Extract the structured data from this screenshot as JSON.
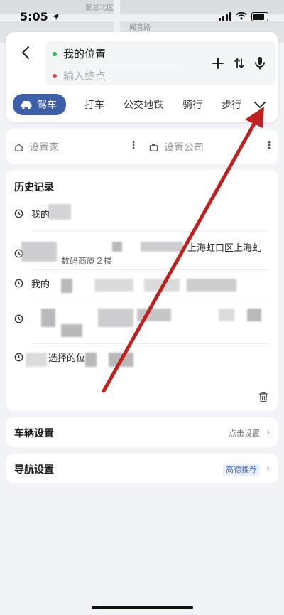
{
  "status_bar": {
    "time": "5:05"
  },
  "map": {
    "road_label_1": "彭兰北区",
    "road_label_2": "闻喜路"
  },
  "route": {
    "start": "我的位置",
    "end_placeholder": "输入终点"
  },
  "modes": {
    "drive": "驾车",
    "taxi": "打车",
    "transit": "公交地铁",
    "bike": "骑行",
    "walk": "步行"
  },
  "places": {
    "home": "设置家",
    "work": "设置公司"
  },
  "history": {
    "title": "历史记录",
    "items": [
      {
        "text": "我的"
      },
      {
        "text": "数码商厦２楼",
        "text2": "上海虹口区上海虬"
      },
      {
        "text": "我的"
      },
      {
        "text": ""
      },
      {
        "text": "选择的位"
      }
    ]
  },
  "vehicle_settings": {
    "label": "车辆设置",
    "value": "点击设置"
  },
  "nav_settings": {
    "label": "导航设置",
    "value": "高德推荐"
  },
  "colors": {
    "accent": "#3d5fa8",
    "start_dot": "#2db84d",
    "end_dot": "#e0463d",
    "annotation_arrow": "#c0211e"
  }
}
